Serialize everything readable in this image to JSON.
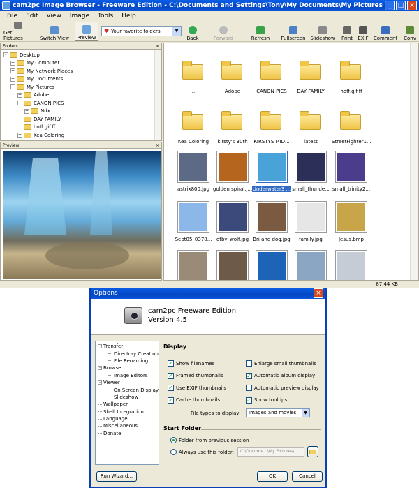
{
  "app": {
    "title": "cam2pc Image Browser - Freeware Edition - C:\\Documents and Settings\\Tony\\My Documents\\My Pictures",
    "menu": [
      "File",
      "Edit",
      "View",
      "Image",
      "Tools",
      "Help"
    ],
    "toolbar": {
      "get_pictures": "Get Pictures",
      "switch_view": "Switch View",
      "preview": "Preview",
      "favorites": "Your favorite folders",
      "back": "Back",
      "forward": "Forward",
      "refresh": "Refresh",
      "fullscreen": "Fullscreen",
      "slideshow": "Slideshow",
      "print": "Print",
      "exif": "EXIF",
      "comment": "Comment",
      "convert": "Conv"
    },
    "folders_header": "Folders",
    "preview_header": "Preview",
    "tree": [
      {
        "label": "Desktop",
        "level": 0,
        "exp": "-"
      },
      {
        "label": "My Computer",
        "level": 1,
        "exp": "+"
      },
      {
        "label": "My Network Places",
        "level": 1,
        "exp": "+"
      },
      {
        "label": "My Documents",
        "level": 1,
        "exp": "+"
      },
      {
        "label": "My Pictures",
        "level": 1,
        "exp": "-"
      },
      {
        "label": "Adobe",
        "level": 2,
        "exp": "+"
      },
      {
        "label": "CANON PICS",
        "level": 2,
        "exp": "-"
      },
      {
        "label": "Ndx",
        "level": 3,
        "exp": "+"
      },
      {
        "label": "DAY FAMILY",
        "level": 2,
        "exp": ""
      },
      {
        "label": "hoff.gif.ff",
        "level": 2,
        "exp": ""
      },
      {
        "label": "Kea Coloring",
        "level": 2,
        "exp": "+"
      }
    ],
    "files": [
      {
        "label": "..",
        "kind": "folder-up"
      },
      {
        "label": "Adobe",
        "kind": "folder"
      },
      {
        "label": "CANON PICS",
        "kind": "folder"
      },
      {
        "label": "DAY FAMILY",
        "kind": "folder"
      },
      {
        "label": "hoff.gif.ff",
        "kind": "folder"
      },
      {
        "label": "Kea Coloring",
        "kind": "folder"
      },
      {
        "label": "kirsty's 30th",
        "kind": "folder"
      },
      {
        "label": "KIRSTYS MID...",
        "kind": "folder"
      },
      {
        "label": "latest",
        "kind": "folder"
      },
      {
        "label": "StreetFighter1...",
        "kind": "folder"
      },
      {
        "label": "astrix800.jpg",
        "kind": "image",
        "color": "#5d6a86"
      },
      {
        "label": "golden spiral.j...",
        "kind": "image",
        "color": "#b5651d"
      },
      {
        "label": "Underwater3 ...",
        "kind": "image",
        "color": "#4aa3d8",
        "selected": true
      },
      {
        "label": "small_thunde...",
        "kind": "image",
        "color": "#2c2f58"
      },
      {
        "label": "small_trinity2...",
        "kind": "image",
        "color": "#4b3c8c"
      },
      {
        "label": "Sept05_0370...",
        "kind": "image",
        "color": "#8bb8e8"
      },
      {
        "label": "otbv_wolf.jpg",
        "kind": "image",
        "color": "#3b4a7a"
      },
      {
        "label": "Bri and dog.jpg",
        "kind": "image",
        "color": "#7a5a40"
      },
      {
        "label": "family.jpg",
        "kind": "image",
        "color": "#e6e6e6"
      },
      {
        "label": "Jesus.bmp",
        "kind": "image",
        "color": "#c9a54a"
      },
      {
        "label": "",
        "kind": "image",
        "color": "#9a8b78"
      },
      {
        "label": "",
        "kind": "image",
        "color": "#6d5a48"
      },
      {
        "label": "",
        "kind": "image",
        "color": "#1d63b8"
      },
      {
        "label": "",
        "kind": "image",
        "color": "#8aa6c2"
      },
      {
        "label": "",
        "kind": "image",
        "color": "#c6ccd6"
      }
    ],
    "status_size": "87.44 KB"
  },
  "dialog": {
    "title": "Options",
    "close": "×",
    "product_name": "cam2pc Freeware Edition",
    "version": "Version 4.5",
    "tree": [
      {
        "label": "Transfer",
        "type": "root",
        "exp": "-"
      },
      {
        "label": "Directory Creation",
        "type": "sub"
      },
      {
        "label": "File Renaming",
        "type": "sub"
      },
      {
        "label": "Browser",
        "type": "root",
        "exp": "-"
      },
      {
        "label": "Image Editors",
        "type": "sub"
      },
      {
        "label": "Viewer",
        "type": "root",
        "exp": "-"
      },
      {
        "label": "On Screen Display",
        "type": "sub"
      },
      {
        "label": "Slideshow",
        "type": "sub"
      },
      {
        "label": "Wallpaper",
        "type": "leaf"
      },
      {
        "label": "Shell Integration",
        "type": "leaf"
      },
      {
        "label": "Language",
        "type": "leaf"
      },
      {
        "label": "Miscellaneous",
        "type": "leaf"
      },
      {
        "label": "Donate",
        "type": "leaf"
      }
    ],
    "display_header": "Display",
    "checks_left": [
      {
        "label": "Show filenames",
        "checked": true
      },
      {
        "label": "Framed thumbnails",
        "checked": true
      },
      {
        "label": "Use EXIF thumbnails",
        "checked": true
      },
      {
        "label": "Cache thumbnails",
        "checked": true
      }
    ],
    "checks_right": [
      {
        "label": "Enlarge small thumbnails",
        "checked": false
      },
      {
        "label": "Automatic album display",
        "checked": true
      },
      {
        "label": "Automatic preview display",
        "checked": false
      },
      {
        "label": "Show tooltips",
        "checked": true
      }
    ],
    "file_types_label": "File types to display",
    "file_types_value": "Images and movies",
    "start_folder_header": "Start Folder",
    "radio_previous": "Folder from previous session",
    "radio_always": "Always use this folder:",
    "path_value": "C:\\Docume...\\My Pictures\\",
    "run_wizard": "Run Wizard...",
    "ok": "OK",
    "cancel": "Cancel",
    "colors": {
      "title_bar": "#0a5ee6",
      "selection": "#316ac5",
      "check": "#21a121"
    }
  }
}
